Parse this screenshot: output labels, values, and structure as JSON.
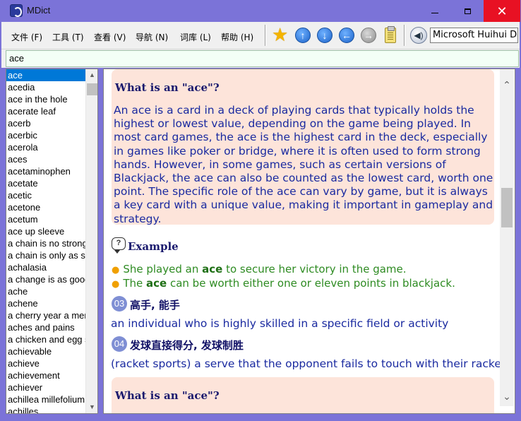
{
  "window": {
    "title": "MDict",
    "controls": {
      "minimize": "minimize",
      "maximize": "maximize",
      "close": "✕"
    }
  },
  "menu": [
    {
      "label": "文件 (F)"
    },
    {
      "label": "工具 (T)"
    },
    {
      "label": "查看 (V)"
    },
    {
      "label": "导航 (N)"
    },
    {
      "label": "词库 (L)"
    },
    {
      "label": "帮助 (H)"
    }
  ],
  "toolbar": {
    "icons": [
      "star-icon",
      "arrow-up-icon",
      "arrow-down-icon",
      "arrow-left-icon",
      "arrow-right-icon",
      "clipboard-icon",
      "speaker-icon"
    ],
    "voice": "Microsoft Huihui Desktop"
  },
  "search": {
    "value": "ace"
  },
  "wordlist": {
    "selected": "ace",
    "items": [
      "ace",
      "acedia",
      "ace in the hole",
      "acerate leaf",
      "acerb",
      "acerbic",
      "acerola",
      "aces",
      "acetaminophen",
      "acetate",
      "acetic",
      "acetone",
      "acetum",
      "ace up sleeve",
      "a chain is no stronger than its weakest link",
      "a chain is only as strong as its weakest link",
      "achalasia",
      "a change is as good as a rest",
      "ache",
      "achene",
      "a cherry year a merry year",
      "aches and pains",
      "a chicken and egg situation",
      "achievable",
      "achieve",
      "achievement",
      "achiever",
      "achillea millefolium",
      "achilles"
    ]
  },
  "entry": {
    "qa1": {
      "title": "What is an \"ace\"?",
      "body": "An ace is a card in a deck of playing cards that typically holds the highest or lowest value, depending on the game being played. In most card games, the ace is the highest card in the deck, especially in games like poker or bridge, where it is often used to form strong hands. However, in some games, such as certain versions of Blackjack, the ace can also be counted as the lowest card, worth one point. The specific role of the ace can vary by game, but it is always a key card with a unique value, making it important in gameplay and strategy."
    },
    "example": {
      "label": "Example",
      "icon_glyph": "?",
      "sentences": [
        {
          "before": "She played an ",
          "keyword": "ace",
          "after": " to secure her victory in the game."
        },
        {
          "before": "The ",
          "keyword": "ace",
          "after": " can be worth either one or eleven points in blackjack."
        }
      ]
    },
    "senses": [
      {
        "num": "03",
        "zh": "高手, 能手",
        "def": "an individual who is highly skilled in a specific field or activity"
      },
      {
        "num": "04",
        "zh": "发球直接得分, 发球制胜",
        "def": "(racket sports) a serve that the opponent fails to touch with their racket"
      }
    ],
    "qa2": {
      "title": "What is an \"ace\"?"
    }
  },
  "colors": {
    "titlebar": "#7b73d8",
    "close_button": "#e81123",
    "selection": "#0078d7",
    "qa_background": "#fde4da",
    "example_text": "#2e8b22",
    "body_text": "#1a2aa0"
  }
}
